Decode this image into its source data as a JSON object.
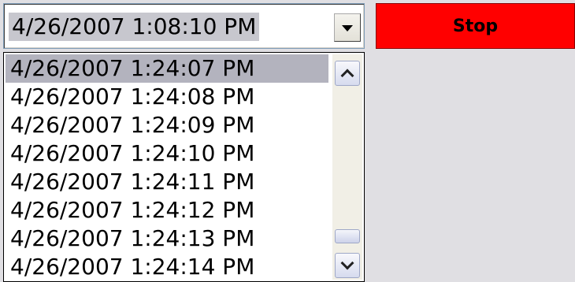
{
  "combo": {
    "selected_value": "4/26/2007 1:08:10 PM",
    "dropdown_icon": "triangle-down-icon"
  },
  "stop_button": {
    "label": "Stop",
    "color": "#ff0000"
  },
  "list": {
    "items": [
      {
        "label": "4/26/2007 1:24:07 PM",
        "selected": true
      },
      {
        "label": "4/26/2007 1:24:08 PM",
        "selected": false
      },
      {
        "label": "4/26/2007 1:24:09 PM",
        "selected": false
      },
      {
        "label": "4/26/2007 1:24:10 PM",
        "selected": false
      },
      {
        "label": "4/26/2007 1:24:11 PM",
        "selected": false
      },
      {
        "label": "4/26/2007 1:24:12 PM",
        "selected": false
      },
      {
        "label": "4/26/2007 1:24:13 PM",
        "selected": false
      },
      {
        "label": "4/26/2007 1:24:14 PM",
        "selected": false
      }
    ],
    "scroll_up_icon": "chevron-up-icon",
    "scroll_down_icon": "chevron-down-icon"
  }
}
